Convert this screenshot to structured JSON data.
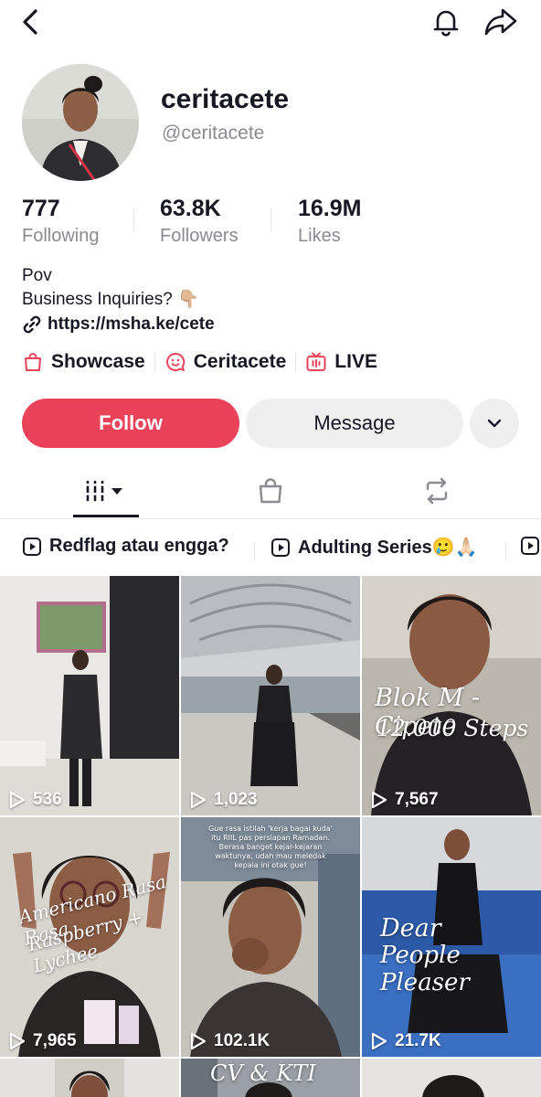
{
  "profile": {
    "username": "ceritacete",
    "handle": "@ceritacete",
    "bio_line1": "Pov",
    "bio_line2": "Business Inquiries? 👇🏼",
    "link": "https://msha.ke/cete"
  },
  "stats": [
    {
      "value": "777",
      "label": "Following"
    },
    {
      "value": "63.8K",
      "label": "Followers"
    },
    {
      "value": "16.9M",
      "label": "Likes"
    }
  ],
  "badges": [
    {
      "label": "Showcase",
      "icon": "shopping-bag-icon"
    },
    {
      "label": "Ceritacete",
      "icon": "creator-chat-icon"
    },
    {
      "label": "LIVE",
      "icon": "tv-icon"
    }
  ],
  "actions": {
    "follow_label": "Follow",
    "message_label": "Message"
  },
  "tabs": [
    {
      "name": "videos",
      "icon": "grid-bars-icon",
      "selected": true
    },
    {
      "name": "shop",
      "icon": "shopping-bag-icon"
    },
    {
      "name": "reposts",
      "icon": "repost-icon"
    }
  ],
  "playlists": [
    {
      "label": "Redflag atau engga?"
    },
    {
      "label": "Adulting Series🥲🙏🏻"
    }
  ],
  "videos": [
    {
      "views": "536"
    },
    {
      "views": "1,023"
    },
    {
      "views": "7,567",
      "overlay": "Blok M - Cipete",
      "overlay2": "12.000 Steps"
    },
    {
      "views": "7,965",
      "overlay": "Americano Rasa Rasa",
      "overlay2": "Raspberry + Lychee"
    },
    {
      "views": "102.1K",
      "overlay": "Gue rasa istilah 'kerja bagai kuda' itu RIIL pas persiapan Ramadan. Berasa banget kejar-kejaran waktunya, udah mau meledak kepala ini otak gue!"
    },
    {
      "views": "21.7K",
      "overlay": "Dear",
      "overlay2": "People Pleaser"
    },
    {
      "overlay": "CV & KTI"
    }
  ],
  "colors": {
    "accent": "#ea4359",
    "text": "#161823",
    "secondary_text": "#8a8b91",
    "button_bg": "#efeff0"
  }
}
